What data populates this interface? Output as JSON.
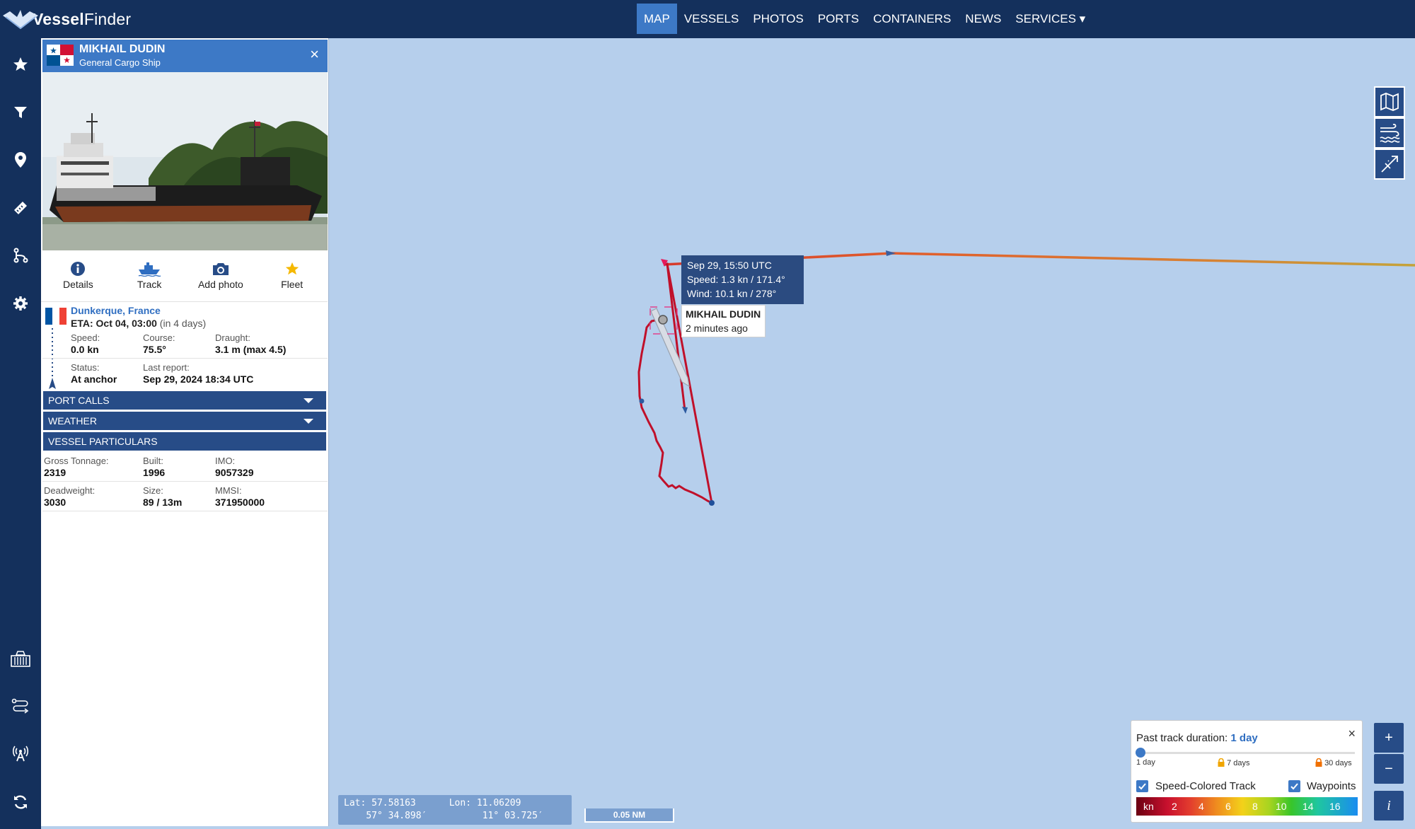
{
  "brand": {
    "name_bold": "Vessel",
    "name_rest": "Finder"
  },
  "nav": [
    "MAP",
    "VESSELS",
    "PHOTOS",
    "PORTS",
    "CONTAINERS",
    "NEWS",
    "SERVICES ▾"
  ],
  "vessel": {
    "name": "MIKHAIL DUDIN",
    "type": "General Cargo Ship",
    "close": "×",
    "actions": [
      "Details",
      "Track",
      "Add photo",
      "Fleet"
    ],
    "destination": "Dunkerque, France",
    "eta": "ETA: Oct 04, 03:00",
    "eta_rel": "(in 4 days)",
    "speed_label": "Speed:",
    "speed": "0.0 kn",
    "course_label": "Course:",
    "course": "75.5°",
    "draught_label": "Draught:",
    "draught": "3.1 m (max 4.5)",
    "status_label": "Status:",
    "status": "At anchor",
    "last_report_label": "Last report:",
    "last_report": "Sep 29, 2024 18:34 UTC",
    "sections": [
      "PORT CALLS",
      "WEATHER",
      "VESSEL PARTICULARS"
    ],
    "gt_label": "Gross Tonnage:",
    "gt": "2319",
    "built_label": "Built:",
    "built": "1996",
    "imo_label": "IMO:",
    "imo": "9057329",
    "dwt_label": "Deadweight:",
    "dwt": "3030",
    "size_label": "Size:",
    "size": "89 / 13m",
    "mmsi_label": "MMSI:",
    "mmsi": "371950000"
  },
  "track_tip": {
    "time": "Sep 29, 15:50 UTC",
    "speed": "Speed: 1.3 kn / 171.4°",
    "wind": "Wind: 10.1 kn / 278°"
  },
  "vessel_tip": {
    "name": "MIKHAIL DUDIN",
    "ago": "2 minutes ago"
  },
  "coords": {
    "lat": "Lat: 57.58163",
    "lon": "Lon: 11.06209",
    "lat_dms": "57° 34.898′",
    "lon_dms": "11° 03.725′"
  },
  "scale": "0.05 NM",
  "past_track": {
    "title": "Past track duration:",
    "value": "1 day",
    "close": "×",
    "opt1": "1 day",
    "opt2": "7 days",
    "opt3": "30 days",
    "speed_colored": "Speed-Colored Track",
    "waypoints": "Waypoints",
    "legend": [
      "kn",
      "2",
      "4",
      "6",
      "8",
      "10",
      "14",
      "16"
    ]
  },
  "zoom": {
    "in": "+",
    "out": "−",
    "info": "i"
  },
  "colors": {
    "topbar": "#14305c",
    "accent": "#3d79c6",
    "section": "#274c87",
    "sea": "#b6cfec",
    "track": "#c0102a"
  }
}
